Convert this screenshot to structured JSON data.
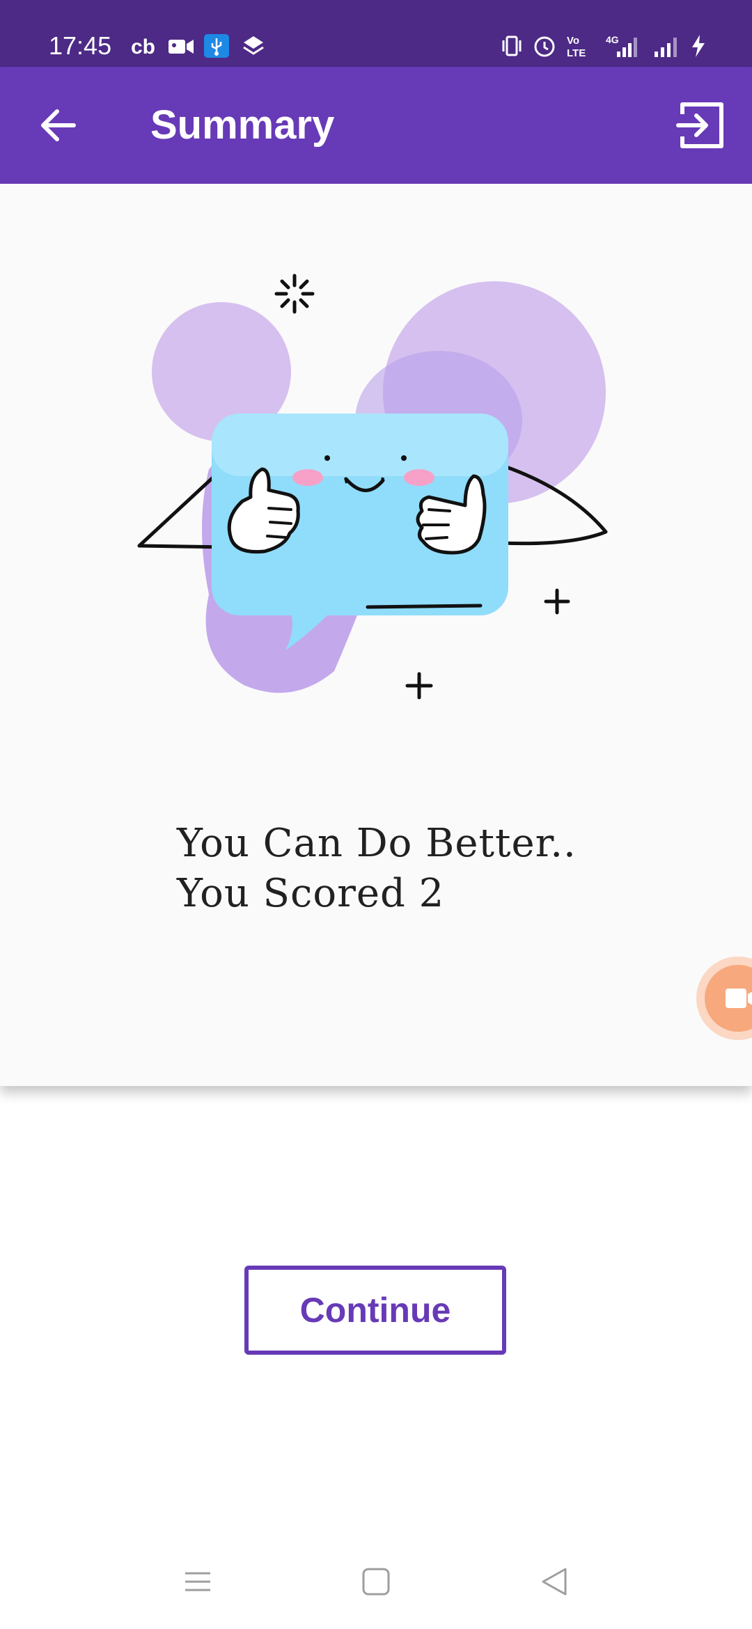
{
  "status_bar": {
    "time": "17:45",
    "left_icons": [
      "cb-icon",
      "video-camera-icon",
      "usb-debug-icon",
      "layers-icon"
    ],
    "right_icons": [
      "vibrate-icon",
      "alarm-icon",
      "volte-icon",
      "4g-signal-icon",
      "signal-icon",
      "charging-icon"
    ],
    "background": "#4c2a86"
  },
  "app_bar": {
    "title": "Summary",
    "back_icon": "arrow-left-icon",
    "exit_icon": "exit-icon",
    "background": "#673ab7"
  },
  "result": {
    "line1": "You Can Do Better..",
    "line2": "You Scored 2"
  },
  "actions": {
    "continue_label": "Continue",
    "accent": "#673ab7"
  },
  "nav_bar": {
    "icons": [
      "menu-icon",
      "home-icon",
      "back-triangle-icon"
    ]
  }
}
